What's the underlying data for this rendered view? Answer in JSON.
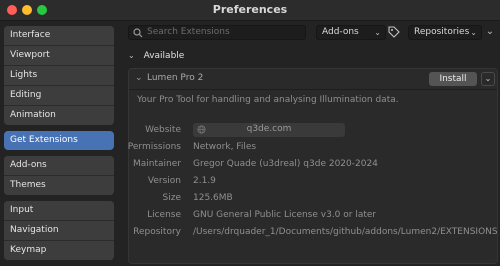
{
  "window": {
    "title": "Preferences"
  },
  "sidebar": {
    "groups": [
      {
        "items": [
          "Interface",
          "Viewport",
          "Lights",
          "Editing",
          "Animation"
        ]
      },
      {
        "items": [
          "Get Extensions"
        ]
      },
      {
        "items": [
          "Add-ons",
          "Themes"
        ]
      },
      {
        "items": [
          "Input",
          "Navigation",
          "Keymap"
        ]
      }
    ],
    "active": "Get Extensions"
  },
  "toolbar": {
    "search_placeholder": "Search Extensions",
    "filter_value": "Add-ons",
    "repositories_label": "Repositories"
  },
  "section": {
    "label": "Available"
  },
  "extension": {
    "name": "Lumen Pro 2",
    "install_label": "Install",
    "description": "Your Pro Tool for handling and analysing Illumination data.",
    "details": [
      {
        "label": "Website",
        "value": "q3de.com"
      },
      {
        "label": "Permissions",
        "value": "Network, Files"
      },
      {
        "label": "Maintainer",
        "value": "Gregor Quade (u3dreal) q3de 2020-2024"
      },
      {
        "label": "Version",
        "value": "2.1.9"
      },
      {
        "label": "Size",
        "value": "125.6MB"
      },
      {
        "label": "License",
        "value": "GNU General Public License v3.0 or later"
      },
      {
        "label": "Repository",
        "value": "/Users/drquader_1/Documents/github/addons/Lumen2/EXTENSIONS"
      }
    ]
  },
  "colors": {
    "accent": "#4772b3",
    "background": "#232323"
  },
  "icons": [
    "search-icon",
    "tag-icon",
    "chevron-down-icon",
    "globe-icon"
  ]
}
